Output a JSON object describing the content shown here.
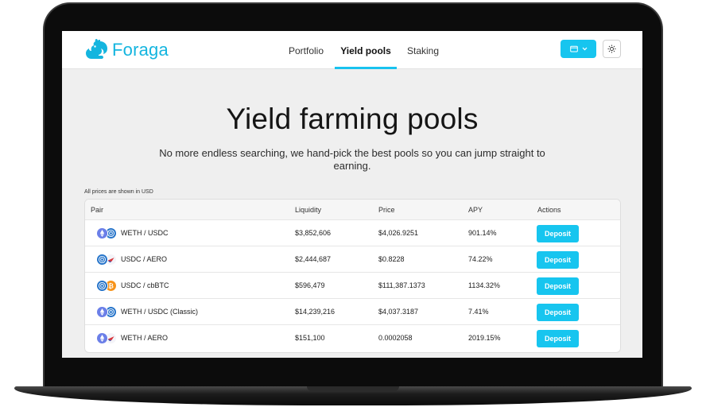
{
  "app": {
    "name": "Foraga"
  },
  "nav": {
    "links": [
      {
        "label": "Portfolio"
      },
      {
        "label": "Yield pools"
      },
      {
        "label": "Staking"
      }
    ],
    "active": "Yield pools"
  },
  "hero": {
    "title": "Yield farming pools",
    "subtitle": "No more endless searching, we hand-pick the best pools so you can jump straight to earning."
  },
  "table": {
    "note": "All prices are shown in USD",
    "columns": [
      "Pair",
      "Liquidity",
      "Price",
      "APY",
      "Actions"
    ],
    "rows": [
      {
        "tokens": [
          "weth-icon",
          "usdc-icon"
        ],
        "pair": "WETH / USDC",
        "liquidity": "$3,852,606",
        "price": "$4,026.9251",
        "apy": "901.14%",
        "action": "Deposit"
      },
      {
        "tokens": [
          "usdc-icon",
          "aero-icon"
        ],
        "pair": "USDC / AERO",
        "liquidity": "$2,444,687",
        "price": "$0.8228",
        "apy": "74.22%",
        "action": "Deposit"
      },
      {
        "tokens": [
          "usdc-icon",
          "cbbtc-icon"
        ],
        "pair": "USDC / cbBTC",
        "liquidity": "$596,479",
        "price": "$111,387.1373",
        "apy": "1134.32%",
        "action": "Deposit"
      },
      {
        "tokens": [
          "weth-icon",
          "usdc-icon"
        ],
        "pair": "WETH / USDC (Classic)",
        "liquidity": "$14,239,216",
        "price": "$4,037.3187",
        "apy": "7.41%",
        "action": "Deposit"
      },
      {
        "tokens": [
          "weth-icon",
          "aero-icon"
        ],
        "pair": "WETH / AERO",
        "liquidity": "$151,100",
        "price": "0.0002058",
        "apy": "2019.15%",
        "action": "Deposit"
      }
    ]
  },
  "colors": {
    "accent": "#17c5ef",
    "brand": "#14b5df",
    "background": "#efefef"
  }
}
